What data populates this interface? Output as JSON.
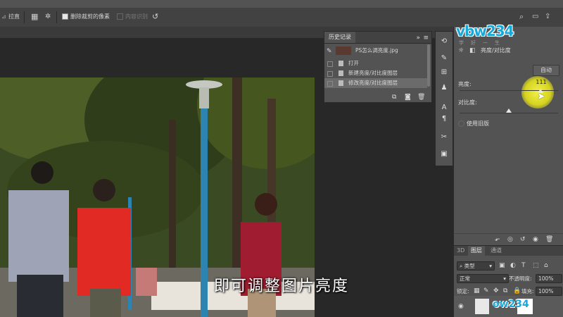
{
  "options_bar": {
    "straighten_label": "拉直",
    "delete_cropped_label": "删除裁剪的像素",
    "content_aware_label": "内容识别"
  },
  "history_panel": {
    "title": "历史记录",
    "snapshot_name": "PS怎么调亮度.jpg",
    "items": [
      {
        "label": "打开"
      },
      {
        "label": "新建亮度/对比度图层"
      },
      {
        "label": "修改亮度/对比度图层"
      }
    ]
  },
  "properties_panel": {
    "header": "亮度/对比度",
    "auto_button": "自动",
    "brightness_label": "亮度:",
    "brightness_value": "111",
    "contrast_label": "对比度:",
    "use_legacy_label": "使用旧版",
    "brightness_level": 0.82,
    "contrast_level": 0.5
  },
  "layers_panel": {
    "tabs": [
      "3D",
      "图层",
      "通道"
    ],
    "filter_kind": "类型",
    "blend_mode": "正常",
    "opacity_label": "不透明度:",
    "opacity_value": "100%",
    "lock_label": "锁定:",
    "fill_label": "填充:",
    "fill_value": "100%"
  },
  "watermark": {
    "logo_text": "vbw234",
    "logo_sub": "学好一生",
    "logo_small": "ow234"
  },
  "caption": "即可调整图片亮度"
}
